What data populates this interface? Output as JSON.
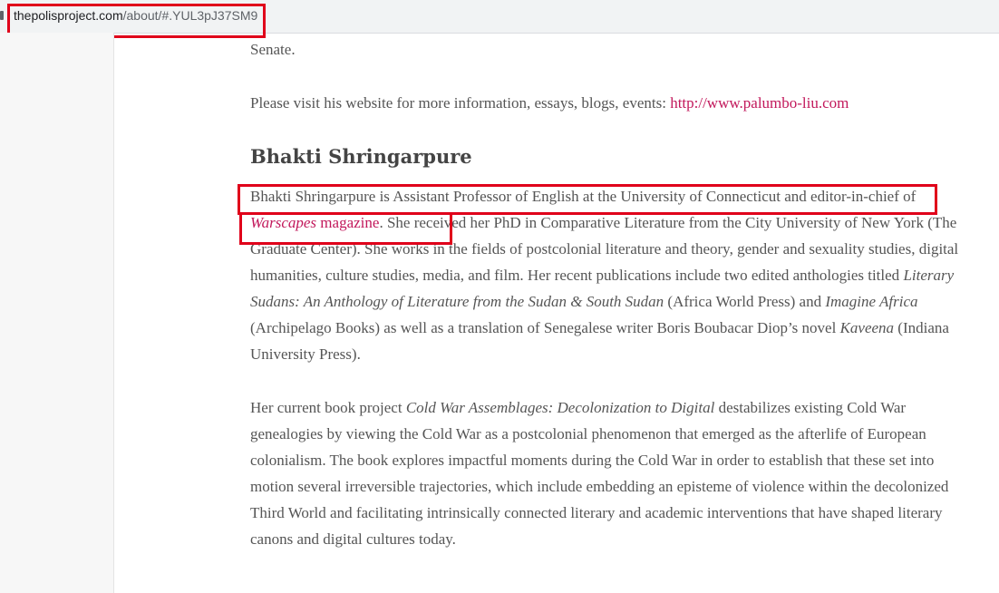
{
  "browser": {
    "url_host": "thepolisproject.com",
    "url_path": "/about/#.YUL3pJ37SM9"
  },
  "article": {
    "prev_tail": "Senate.",
    "visit_text": "Please visit his website for more information, essays, blogs, events: ",
    "visit_link": "http://www.palumbo-liu.com",
    "heading": "Bhakti Shringarpure",
    "p1": {
      "a": "Bhakti Shringarpure is Assistant Professor of English at the University of Connecticut and editor-in-chief of ",
      "link_italic": "Warscapes",
      "link_plain": " magazine",
      "b": ". She received her PhD in Comparative Literature from the City University of New York (The Graduate Center). She works in the fields of postcolonial literature and theory, gender and sexuality studies, digital humanities, culture studies, media, and film. Her recent publications include two edited anthologies titled ",
      "i1": "Literary Sudans: An Anthology of Literature from the Sudan & South Sudan",
      "c": " (Africa World Press) and ",
      "i2": "Imagine Africa",
      "d": " (Archipelago Books) as well as a translation of Senegalese writer Boris Boubacar Diop’s novel ",
      "i3": "Kaveena",
      "e": " (Indiana University Press)."
    },
    "p2": {
      "a": "Her current book project ",
      "i1": "Cold War Assemblages: Decolonization to Digital",
      "b": " destabilizes existing Cold War genealogies by viewing the Cold War as a postcolonial phenomenon that emerged as the afterlife of European colonialism. The book explores impactful moments during the Cold War in order to establish that these set into motion several irreversible trajectories, which include embedding an episteme of violence within the decolonized Third World and facilitating intrinsically connected literary and academic interventions that have shaped literary canons and digital cultures today."
    }
  }
}
